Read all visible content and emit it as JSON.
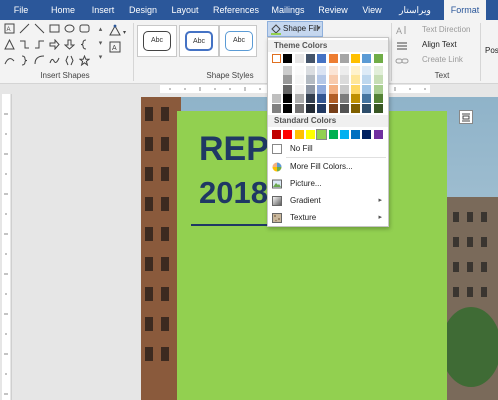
{
  "tabs": [
    "File",
    "Home",
    "Insert",
    "Design",
    "Layout",
    "References",
    "Mailings",
    "Review",
    "View",
    "ویراستار",
    "Format"
  ],
  "groups": {
    "insert_shapes": "Insert Shapes",
    "shape_styles": "Shape Styles",
    "text": "Text"
  },
  "style_samples": [
    "Abc",
    "Abc",
    "Abc"
  ],
  "shape_fill": {
    "label": "Shape Fill",
    "arrow": "▾"
  },
  "text_group": {
    "text_direction": "Text Direction",
    "align_text": "Align Text",
    "create_link": "Create Link"
  },
  "position_label": "Posi",
  "document": {
    "title_line1": "REPO          LE",
    "title_line2": "2018"
  },
  "fill_menu": {
    "theme_colors_header": "Theme Colors",
    "standard_colors_header": "Standard Colors",
    "items": [
      {
        "label": "No Fill",
        "icon": "no-fill-icon",
        "submenu": false
      },
      {
        "label": "More Fill Colors...",
        "icon": "color-wheel-icon",
        "submenu": false
      },
      {
        "label": "Picture...",
        "icon": "picture-icon",
        "submenu": false
      },
      {
        "label": "Gradient",
        "icon": "gradient-icon",
        "submenu": true
      },
      {
        "label": "Texture",
        "icon": "texture-icon",
        "submenu": true
      }
    ],
    "submenu_arrow": "▸"
  },
  "colors": {
    "tabbar": "#2b579a",
    "green_box": "#92d050",
    "title_text": "#1f3864",
    "theme_rows": [
      [
        "#ffffff",
        "#000000",
        "#e7e6e6",
        "#44546a",
        "#4472c4",
        "#ed7d31",
        "#a5a5a5",
        "#ffc000",
        "#5b9bd5",
        "#70ad47"
      ]
    ],
    "standard": [
      "#c00000",
      "#ff0000",
      "#ffc000",
      "#ffff00",
      "#92d050",
      "#00b050",
      "#00b0f0",
      "#0070c0",
      "#002060",
      "#7030a0"
    ]
  }
}
